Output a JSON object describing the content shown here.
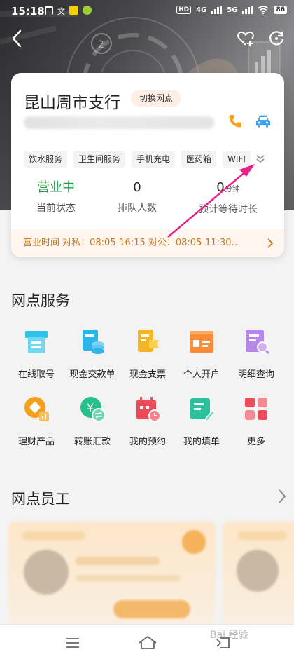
{
  "status_bar": {
    "time": "15:18",
    "network_hd": "HD",
    "net1": "4G",
    "net2": "5G",
    "battery": "86"
  },
  "branch": {
    "name": "昆山周市支行",
    "switch_label": "切换网点"
  },
  "amenities": [
    "饮水服务",
    "卫生间服务",
    "手机充电",
    "医药箱",
    "WIFI"
  ],
  "stats": [
    {
      "value": "营业中",
      "label": "当前状态",
      "unit": ""
    },
    {
      "value": "0",
      "label": "排队人数",
      "unit": ""
    },
    {
      "value": "0",
      "label": "预计等待时长",
      "unit": "分钟"
    }
  ],
  "hours": {
    "text": "营业时间   对私：08:05-16:15  对公：08:05-11:30…"
  },
  "services": {
    "title": "网点服务",
    "items": [
      {
        "label": "在线取号",
        "icon": "ticket-icon",
        "color": "#2ec1ea"
      },
      {
        "label": "现金交款单",
        "icon": "cash-deposit-icon",
        "color": "#2ab6e8"
      },
      {
        "label": "现金支票",
        "icon": "cash-check-icon",
        "color": "#f5b523"
      },
      {
        "label": "个人开户",
        "icon": "id-card-icon",
        "color": "#f78c3a"
      },
      {
        "label": "明细查询",
        "icon": "detail-search-icon",
        "color": "#b587ea"
      },
      {
        "label": "理财产品",
        "icon": "wealth-icon",
        "color": "#f39f1c"
      },
      {
        "label": "转账汇款",
        "icon": "transfer-icon",
        "color": "#27c08a"
      },
      {
        "label": "我的预约",
        "icon": "calendar-icon",
        "color": "#ef4a5a"
      },
      {
        "label": "我的填单",
        "icon": "form-edit-icon",
        "color": "#2ac29a"
      },
      {
        "label": "更多",
        "icon": "more-icon",
        "color": "#ef4a5a"
      }
    ]
  },
  "staff": {
    "title": "网点员工"
  },
  "watermark": "Bai 经验",
  "colors": {
    "open_status": "#16a34a",
    "accent_orange": "#f39a25",
    "hours_text": "#c9761f",
    "arrow": "#e8208a"
  }
}
